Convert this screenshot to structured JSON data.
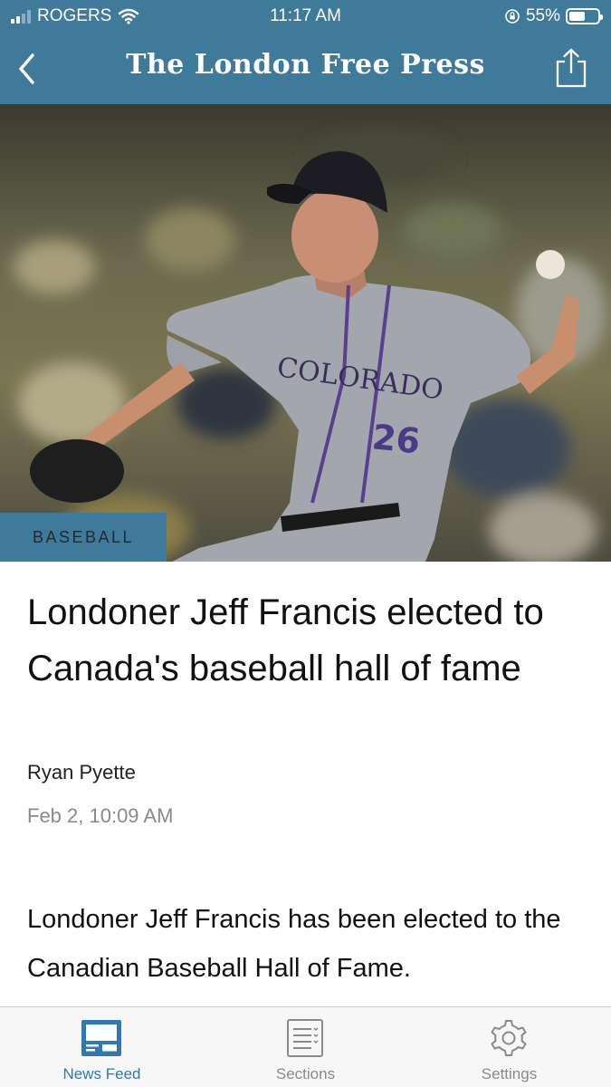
{
  "status_bar": {
    "carrier": "ROGERS",
    "time": "11:17 AM",
    "battery_percent": "55%",
    "battery_level": 0.55,
    "signal_bars": 2
  },
  "nav": {
    "masthead": "The London Free Press",
    "back_icon": "chevron-left-icon",
    "share_icon": "share-icon"
  },
  "article": {
    "category": "BASEBALL",
    "headline": "Londoner Jeff Francis elected to Canada's baseball hall of fame",
    "author": "Ryan Pyette",
    "date": "Feb 2, 10:09 AM",
    "body": "Londoner Jeff Francis has been elected to the Canadian Baseball Hall of Fame.",
    "photo": {
      "jersey_text": "COLORADO",
      "jersey_number": "26"
    }
  },
  "tabbar": {
    "tabs": [
      {
        "label": "News Feed",
        "icon": "news-feed-icon",
        "active": true
      },
      {
        "label": "Sections",
        "icon": "sections-list-icon",
        "active": false
      },
      {
        "label": "Settings",
        "icon": "gear-icon",
        "active": false
      }
    ]
  },
  "colors": {
    "brand": "#3f7a9a",
    "active_tab": "#2f79b0",
    "inactive_tab": "#8a8a8a"
  }
}
